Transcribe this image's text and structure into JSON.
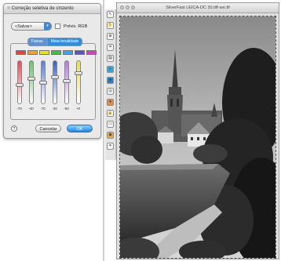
{
  "dialog": {
    "title": "Correção seletiva de cinzento",
    "preset_value": "<Salvar>",
    "preview_label": "Prévis. RGB",
    "tabs": [
      "Faixas",
      "Meia-tonalidade"
    ],
    "swatch_colors": [
      "#e0443a",
      "#f0a030",
      "#e8e030",
      "#40c040",
      "#40a0f0",
      "#6050c0",
      "#d040c0"
    ],
    "bar_colors": [
      "#e74b5a",
      "#6ac26a",
      "#5c7de0",
      "#3b5fbf",
      "#b47ae0",
      "#e6dc5a"
    ],
    "values": [
      "-70",
      "-40",
      "-70",
      "-30",
      "-50",
      "+0"
    ],
    "knob_levels": [
      0.55,
      0.4,
      0.5,
      0.35,
      0.45,
      0.25
    ],
    "help_label": "?",
    "cancel_label": "Cancelar",
    "ok_label": "OK"
  },
  "image_window": {
    "title": "SilverFast LEICA-DC 30.tiff-ser.tif"
  },
  "toolbox": {
    "icons": [
      "arrow-tool-icon",
      "hand-tool-icon",
      "zoom-tool-icon",
      "crop-tool-icon",
      "histogram-icon",
      "gradation-icon",
      "color-icon",
      "selective-color-icon",
      "dust-icon",
      "lock-icon",
      "print-icon",
      "eye-icon",
      "magic-icon"
    ]
  }
}
